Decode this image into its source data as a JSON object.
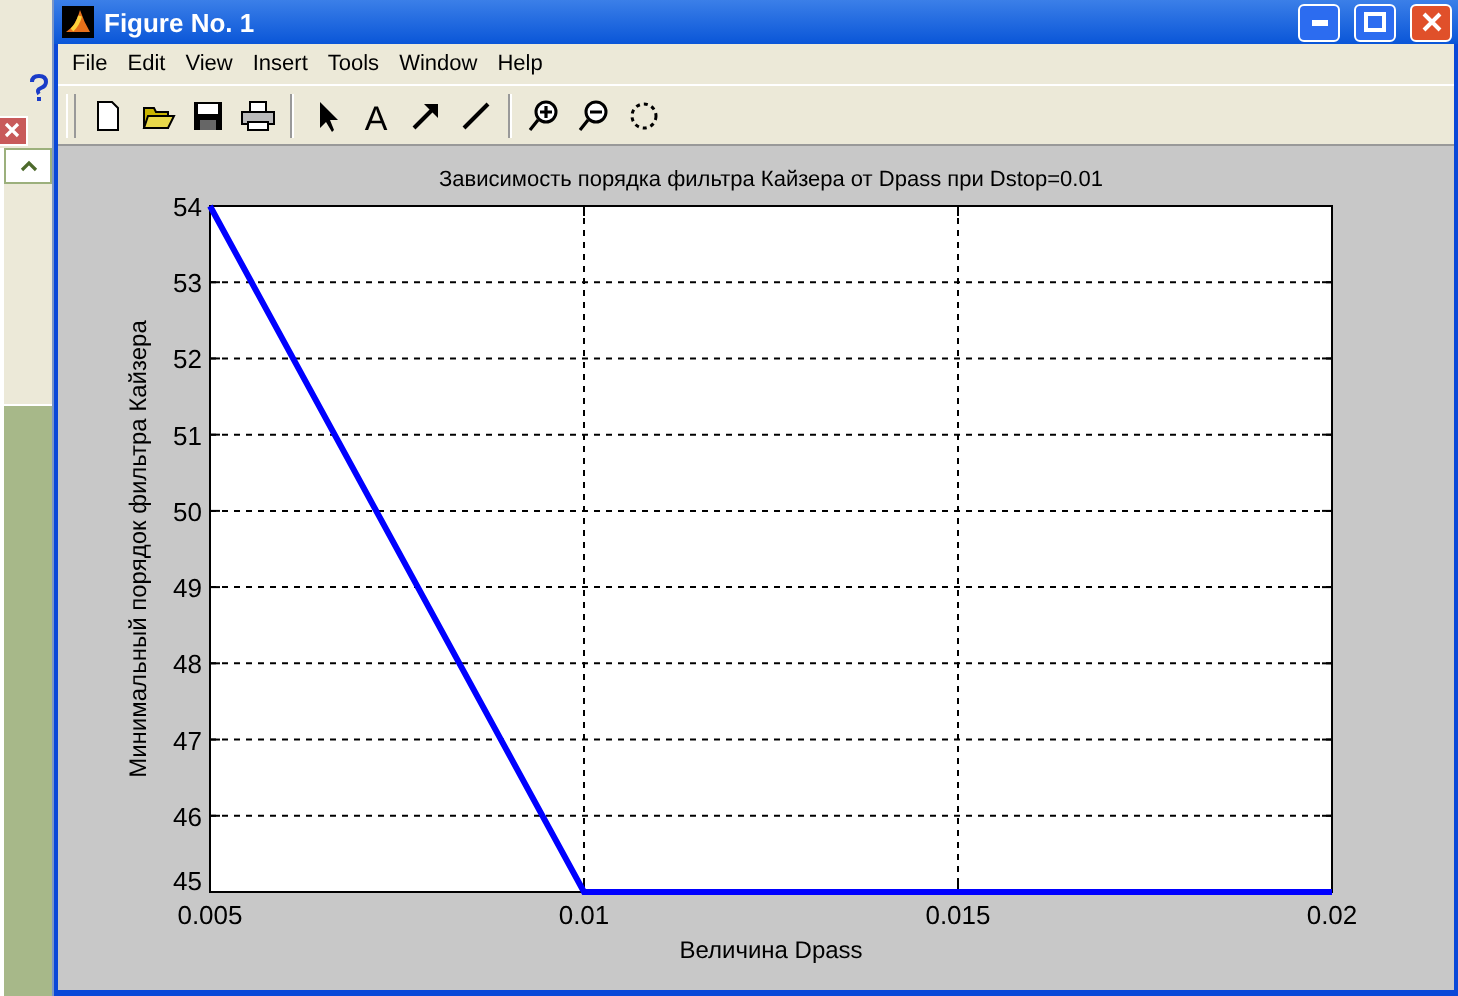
{
  "window": {
    "title": "Figure No. 1"
  },
  "menu": [
    "File",
    "Edit",
    "View",
    "Insert",
    "Tools",
    "Window",
    "Help"
  ],
  "toolbar": [
    {
      "kind": "new"
    },
    {
      "kind": "open"
    },
    {
      "kind": "save"
    },
    {
      "kind": "print"
    },
    {
      "kind": "separator"
    },
    {
      "kind": "pointer"
    },
    {
      "kind": "text",
      "label": "A"
    },
    {
      "kind": "arrow"
    },
    {
      "kind": "line"
    },
    {
      "kind": "separator"
    },
    {
      "kind": "zoom-in"
    },
    {
      "kind": "zoom-out"
    },
    {
      "kind": "rotate"
    }
  ],
  "chart_data": {
    "type": "line",
    "title": "Зависимость порядка фильтра Кайзера от Dpass при Dstop=0.01",
    "xlabel": "Величина Dpass",
    "ylabel": "Минимальный порядок фильтра Кайзера",
    "x": [
      0.005,
      0.01,
      0.02
    ],
    "series": [
      {
        "color": "#0000ff",
        "values": [
          54,
          45,
          45
        ]
      }
    ],
    "xlim": [
      0.005,
      0.02
    ],
    "ylim": [
      45,
      54
    ],
    "xticks": [
      {
        "value": 0.005,
        "label": "0.005"
      },
      {
        "value": 0.01,
        "label": "0.01"
      },
      {
        "value": 0.015,
        "label": "0.015"
      },
      {
        "value": 0.02,
        "label": "0.02"
      }
    ],
    "yticks": [
      45,
      46,
      47,
      48,
      49,
      50,
      51,
      52,
      53,
      54
    ],
    "grid": true
  }
}
